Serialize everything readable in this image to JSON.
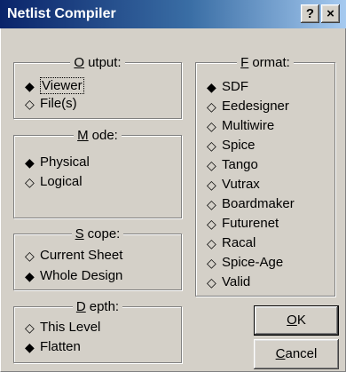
{
  "window": {
    "title": "Netlist Compiler",
    "help_glyph": "?",
    "close_glyph": "×"
  },
  "output": {
    "legend_accel": "O",
    "legend_rest": "utput:",
    "options": [
      {
        "label": "Viewer",
        "selected": true
      },
      {
        "label": "File(s)",
        "selected": false
      }
    ]
  },
  "mode": {
    "legend_accel": "M",
    "legend_rest": "ode:",
    "options": [
      {
        "label": "Physical",
        "selected": true
      },
      {
        "label": "Logical",
        "selected": false
      }
    ]
  },
  "scope": {
    "legend_accel": "S",
    "legend_rest": "cope:",
    "options": [
      {
        "label": "Current Sheet",
        "selected": false
      },
      {
        "label": "Whole Design",
        "selected": true
      }
    ]
  },
  "depth": {
    "legend_accel": "D",
    "legend_rest": "epth:",
    "options": [
      {
        "label": "This Level",
        "selected": false
      },
      {
        "label": "Flatten",
        "selected": true
      }
    ]
  },
  "format": {
    "legend_accel": "F",
    "legend_rest": "ormat:",
    "options": [
      {
        "label": "SDF",
        "selected": true
      },
      {
        "label": "Eedesigner",
        "selected": false
      },
      {
        "label": "Multiwire",
        "selected": false
      },
      {
        "label": "Spice",
        "selected": false
      },
      {
        "label": "Tango",
        "selected": false
      },
      {
        "label": "Vutrax",
        "selected": false
      },
      {
        "label": "Boardmaker",
        "selected": false
      },
      {
        "label": "Futurenet",
        "selected": false
      },
      {
        "label": "Racal",
        "selected": false
      },
      {
        "label": "Spice-Age",
        "selected": false
      },
      {
        "label": "Valid",
        "selected": false
      }
    ]
  },
  "buttons": {
    "ok_accel": "O",
    "ok_rest": "K",
    "cancel_accel": "C",
    "cancel_rest": "ancel"
  },
  "glyphs": {
    "selected": "◆",
    "unselected": "◇"
  }
}
